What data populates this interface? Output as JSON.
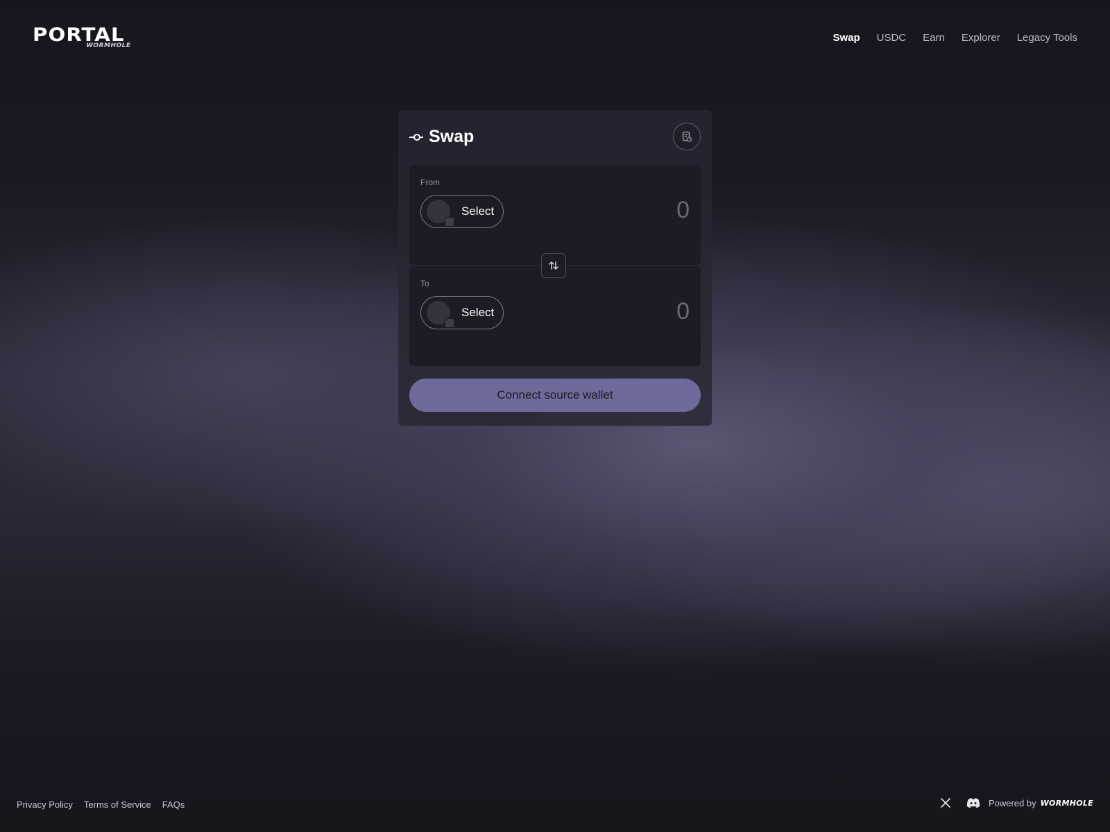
{
  "header": {
    "logo": "PORTAL",
    "logo_sub": "WORMHOLE",
    "nav": [
      {
        "label": "Swap",
        "active": true
      },
      {
        "label": "USDC",
        "active": false
      },
      {
        "label": "Earn",
        "active": false
      },
      {
        "label": "Explorer",
        "active": false
      },
      {
        "label": "Legacy Tools",
        "active": false
      }
    ]
  },
  "swap": {
    "title": "Swap",
    "from": {
      "label": "From",
      "select_label": "Select",
      "amount": "0"
    },
    "to": {
      "label": "To",
      "select_label": "Select",
      "amount": "0"
    },
    "connect_button": "Connect source wallet"
  },
  "footer": {
    "links": [
      "Privacy Policy",
      "Terms of Service",
      "FAQs"
    ],
    "powered_by": "Powered by",
    "powered_brand": "WORMHOLE"
  },
  "icons": {
    "title": "swap-commit-icon",
    "history": "transaction-history-icon",
    "swap_direction": "swap-arrows-icon",
    "social": [
      "x-icon",
      "discord-icon"
    ]
  },
  "colors": {
    "background": "#17161e",
    "card": "#282632",
    "panel": "#1d1c24",
    "accent_button": "#6f6a9c"
  }
}
